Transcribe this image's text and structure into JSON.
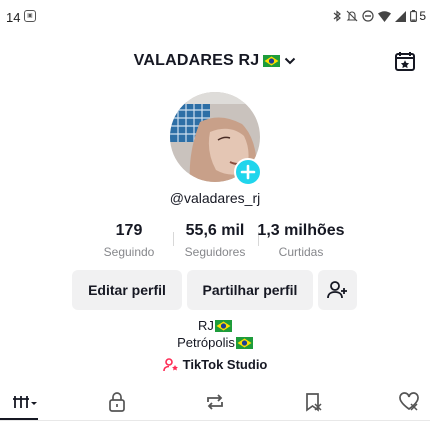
{
  "status_bar": {
    "time": "14",
    "app_icon": "notification-app-icon",
    "battery": "5",
    "icons": [
      "bluetooth-icon",
      "mute-icon",
      "do-not-disturb-icon",
      "wifi-icon",
      "signal-icon",
      "battery-icon"
    ]
  },
  "header": {
    "name": "VALADARES RJ",
    "flag": "brazil-flag",
    "dropdown_icon": "chevron-down-icon",
    "right_icon": "calendar-star-icon"
  },
  "profile": {
    "username": "@valadares_rj",
    "avatar_icon": "avatar",
    "add_icon": "plus-icon"
  },
  "stats": [
    {
      "value": "179",
      "label": "Seguindo"
    },
    {
      "value": "55,6 mil",
      "label": "Seguidores"
    },
    {
      "value": "1,3 milhões",
      "label": "Curtidas"
    }
  ],
  "buttons": {
    "edit": "Editar perfil",
    "share": "Partilhar perfil",
    "add_friend_icon": "add-user-icon"
  },
  "bio": {
    "line1": "RJ",
    "line2": "Petrópolis ",
    "studio": "TikTok Studio"
  },
  "tabs": [
    "videos-grid-icon",
    "lock-icon",
    "repost-icon",
    "favorites-icon",
    "liked-icon"
  ],
  "colors": {
    "accent": "#20d5ec",
    "studio_icon": "#fe2c55",
    "text": "#161823",
    "muted": "#86878b",
    "button_bg": "#f1f1f2"
  }
}
